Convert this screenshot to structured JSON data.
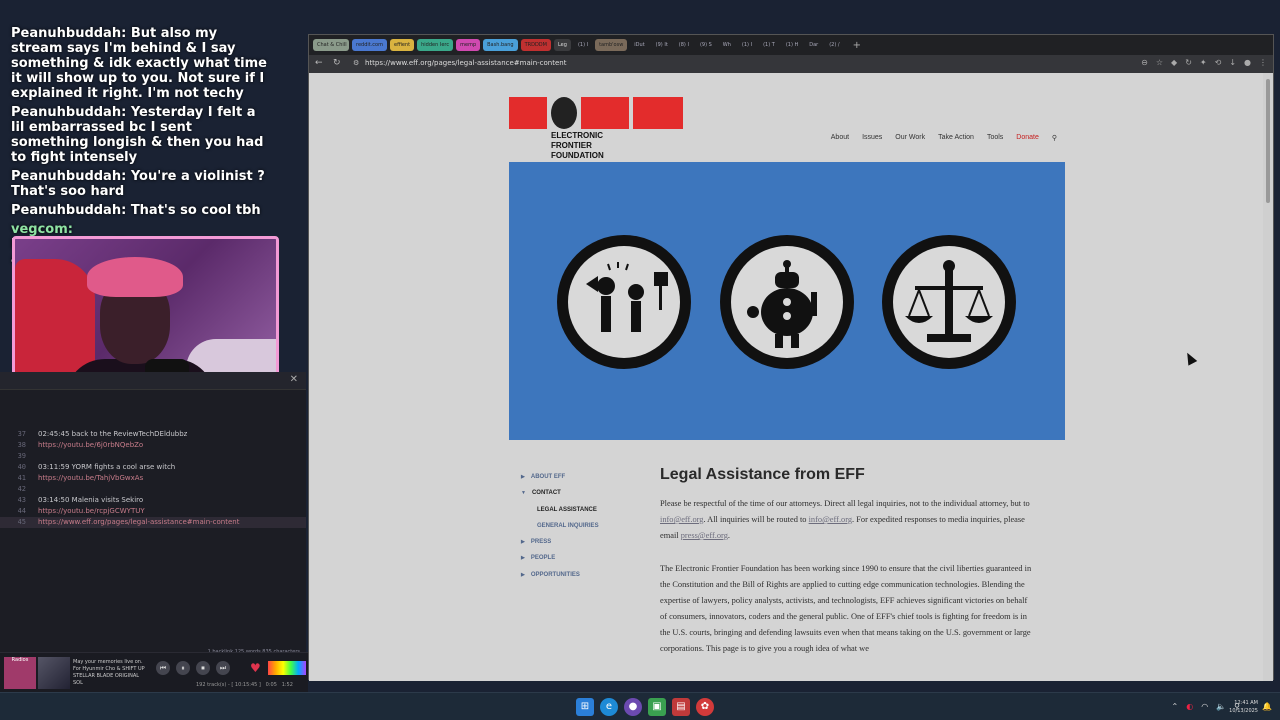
{
  "chat": {
    "messages": [
      {
        "user": "Peanuhbuddah:",
        "text": "But also my stream says I'm behind & I say something & idk exactly what time it will show up to you. Not sure if I explained it right. I'm not techy",
        "color": "#ffffff"
      },
      {
        "user": "Peanuhbuddah:",
        "text": "Yesterday I felt a lil embarrassed bc I sent something longish & then you had to fight intensely",
        "color": "#ffffff"
      },
      {
        "user": "Peanuhbuddah:",
        "text": "You're a violinist ? That's soo hard",
        "color": "#ffffff"
      },
      {
        "user": "Peanuhbuddah:",
        "text": "That's so cool tbh",
        "color": "#ffffff"
      },
      {
        "user": "vegcom:",
        "text": "https://www.eff.org/pages/legal-assistance#main-content",
        "color": "#8fe3a3"
      }
    ]
  },
  "editor": {
    "lines": [
      {
        "num": "37",
        "text": "02:45:45  back to the ReviewTechDEldubbz",
        "link": false
      },
      {
        "num": "38",
        "text": "https://youtu.be/6j0rbNQebZo",
        "link": true
      },
      {
        "num": "39",
        "text": "",
        "link": false
      },
      {
        "num": "40",
        "text": "03:11:59 YORM fights a cool arse witch",
        "link": false
      },
      {
        "num": "41",
        "text": "https://youtu.be/TahjVbGwxAs",
        "link": true
      },
      {
        "num": "42",
        "text": "",
        "link": false
      },
      {
        "num": "43",
        "text": "03:14:50 Malenia visits Sekiro",
        "link": false
      },
      {
        "num": "44",
        "text": "https://youtu.be/rcpjGCWYTUY",
        "link": true
      },
      {
        "num": "45",
        "text": "https://www.eff.org/pages/legal-assistance#main-content",
        "link": true
      }
    ],
    "status": "1 backlink   125 words  835 characters"
  },
  "player": {
    "tag": "Radios",
    "title": "May your memories live on. For Hyunmir Cho & SHIFT UP STELLAR BLADE ORIGINAL SOL",
    "tracks": "192 track(s) - [ 10:15:45 ]",
    "elapsed": "0:05",
    "total": "1:52"
  },
  "browser": {
    "tabs": [
      {
        "label": "Chat & Chill",
        "color": "#8a9a8a"
      },
      {
        "label": "reddit.com",
        "color": "#4a78d0"
      },
      {
        "label": "effient",
        "color": "#d9b340"
      },
      {
        "label": "hidden Ierc",
        "color": "#3aa88a"
      },
      {
        "label": "memp",
        "color": "#d04ab0"
      },
      {
        "label": "Bash.bang",
        "color": "#4aa0d9"
      },
      {
        "label": "TRDDDM",
        "color": "#c03030"
      },
      {
        "label": "Leg",
        "color": "active"
      },
      {
        "label": "(1) I",
        "color": "plain"
      },
      {
        "label": "tamb'osw",
        "color": "#7a6a5a"
      },
      {
        "label": "iDut",
        "color": "plain"
      },
      {
        "label": "(9) It",
        "color": "plain"
      },
      {
        "label": "(8) I",
        "color": "plain"
      },
      {
        "label": "(9) S",
        "color": "plain"
      },
      {
        "label": "Wh",
        "color": "plain"
      },
      {
        "label": "(1) I",
        "color": "plain"
      },
      {
        "label": "(1) T",
        "color": "plain"
      },
      {
        "label": "(1) H",
        "color": "plain"
      },
      {
        "label": "Dar",
        "color": "plain"
      },
      {
        "label": "(2) /",
        "color": "plain"
      }
    ],
    "url": "https://www.eff.org/pages/legal-assistance#main-content"
  },
  "site": {
    "logo_text": [
      "ELECTRONIC",
      "FRONTIER",
      "FOUNDATION"
    ],
    "nav": [
      "About",
      "Issues",
      "Our Work",
      "Take Action",
      "Tools"
    ],
    "donate": "Donate",
    "sidenav": [
      {
        "label": "ABOUT EFF",
        "caret": "right",
        "sub": false
      },
      {
        "label": "CONTACT",
        "caret": "down",
        "sub": false
      },
      {
        "label": "LEGAL ASSISTANCE",
        "caret": "",
        "sub": true
      },
      {
        "label": "GENERAL INQUIRIES",
        "caret": "",
        "sub": true
      },
      {
        "label": "PRESS",
        "caret": "right",
        "sub": false
      },
      {
        "label": "PEOPLE",
        "caret": "right",
        "sub": false
      },
      {
        "label": "OPPORTUNITIES",
        "caret": "right",
        "sub": false
      }
    ],
    "heading": "Legal Assistance from EFF",
    "p1_a": "Please be respectful of the time of our attorneys. Direct all legal inquiries, not to the individual attorney, but to ",
    "p1_link1": "info@eff.org",
    "p1_b": ". All inquiries will be routed to ",
    "p1_link2": "info@eff.org",
    "p1_c": ". For expedited responses to media inquiries, please email ",
    "p1_link3": "press@eff.org",
    "p1_d": ".",
    "p2": "The Electronic Frontier Foundation has been working since 1990 to ensure that the civil liberties guaranteed in the Constitution and the Bill of Rights are applied to cutting edge communication technologies. Blending the expertise of lawyers, policy analysts, activists, and technologists, EFF achieves significant victories on behalf of consumers, innovators, coders and the general public. One of EFF's chief tools is fighting for freedom is in the U.S. courts, bringing and defending lawsuits even when that means taking on the U.S. government or large corporations. This page is to give you a rough idea of what we"
  },
  "taskbar": {
    "time": "12:41 AM",
    "date": "10/13/2025"
  },
  "colors": {
    "eff_red": "#e32c2c",
    "hero_blue": "#3d76bd",
    "donate_red": "#c62020",
    "page_bg": "#d4d4d4"
  }
}
